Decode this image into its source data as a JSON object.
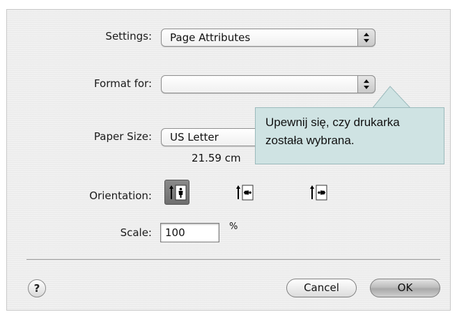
{
  "settings": {
    "label": "Settings:",
    "value": "Page Attributes"
  },
  "format_for": {
    "label": "Format for:",
    "value": ""
  },
  "paper_size": {
    "label": "Paper Size:",
    "value": "US Letter",
    "dimensions": "21.59 cm"
  },
  "orientation": {
    "label": "Orientation:",
    "options": [
      {
        "name": "portrait",
        "selected": true
      },
      {
        "name": "landscape-left",
        "selected": false
      },
      {
        "name": "landscape-right",
        "selected": false
      }
    ]
  },
  "scale": {
    "label": "Scale:",
    "value": "100",
    "unit": "%"
  },
  "buttons": {
    "help": "?",
    "cancel": "Cancel",
    "ok": "OK"
  },
  "callout": {
    "text": "Upewnij się, czy drukarka została wybrana.",
    "background": "#cfe3e3"
  }
}
